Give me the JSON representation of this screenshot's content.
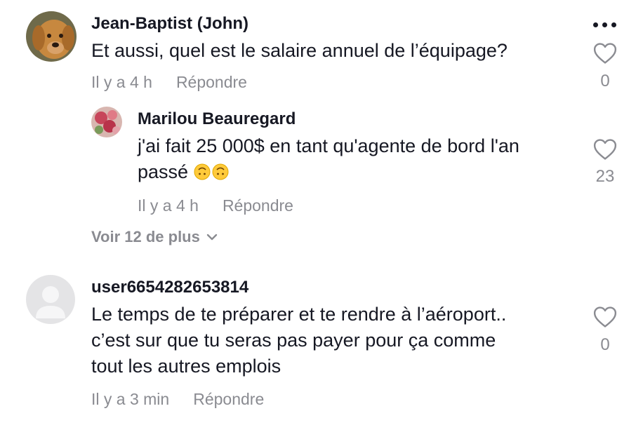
{
  "comments": [
    {
      "username": "Jean-Baptist (John)",
      "avatar": "dog-photo",
      "text": "Et aussi, quel est le salaire annuel de l’équipage?",
      "time": "Il y a 4 h",
      "reply_label": "Répondre",
      "likes": "0"
    },
    {
      "username": "user6654282653814",
      "avatar": "default-user-silhouette",
      "text_lines": [
        "Le temps de te préparer et te rendre à l’aéroport..",
        "c’est sur que tu seras pas payer pour ça comme",
        "tout les autres emplois"
      ],
      "time": "Il y a 3 min",
      "reply_label": "Répondre",
      "likes": "0"
    }
  ],
  "reply": {
    "username": "Marilou Beauregard",
    "avatar": "flowers-photo",
    "text_lines": [
      "j'ai fait 25 000$ en tant qu'agente de bord l'an",
      "passé"
    ],
    "emojis": [
      "upside-down-face",
      "upside-down-face"
    ],
    "time": "Il y a 4 h",
    "reply_label": "Répondre",
    "likes": "23"
  },
  "view_more": {
    "label": "Voir 12 de plus",
    "icon": "chevron-down-icon"
  },
  "options_icon": "more-dots-icon",
  "colors": {
    "text": "#161823",
    "meta": "#8a8b91",
    "background": "#ffffff"
  }
}
